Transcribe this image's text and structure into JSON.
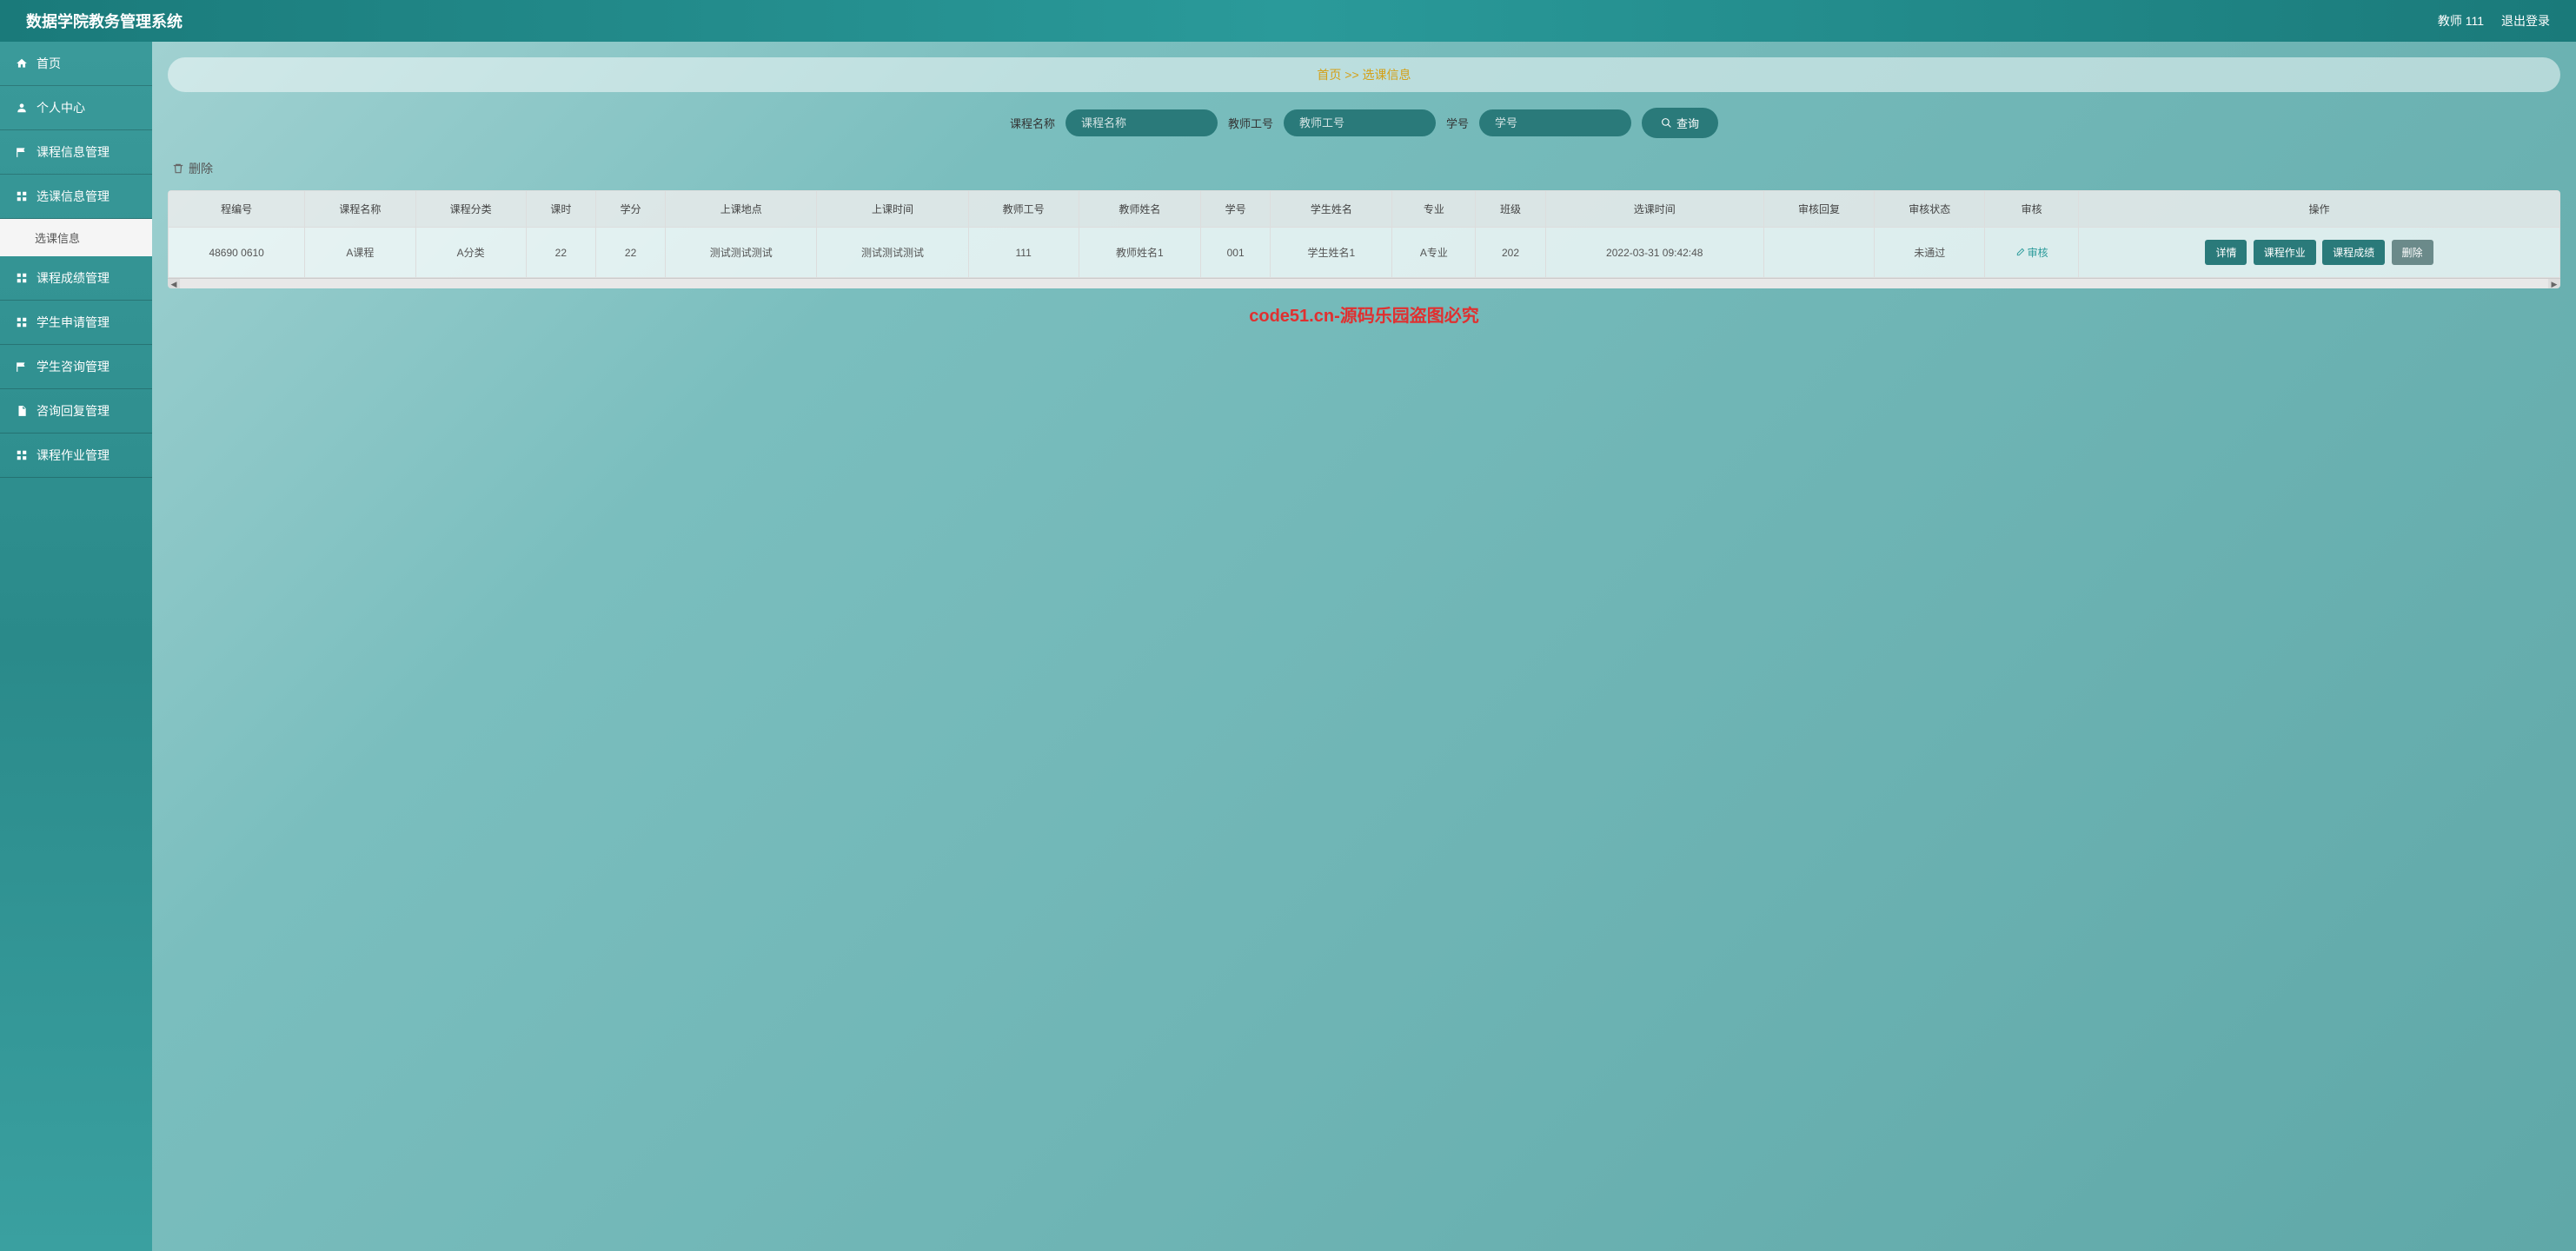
{
  "header": {
    "title": "数据学院教务管理系统",
    "user": "教师 111",
    "logout": "退出登录"
  },
  "sidebar": {
    "items": [
      {
        "icon": "home",
        "label": "首页"
      },
      {
        "icon": "user",
        "label": "个人中心"
      },
      {
        "icon": "flag",
        "label": "课程信息管理"
      },
      {
        "icon": "grid",
        "label": "选课信息管理",
        "sub": [
          {
            "label": "选课信息"
          }
        ]
      },
      {
        "icon": "grid",
        "label": "课程成绩管理"
      },
      {
        "icon": "grid",
        "label": "学生申请管理"
      },
      {
        "icon": "flag",
        "label": "学生咨询管理"
      },
      {
        "icon": "doc",
        "label": "咨询回复管理"
      },
      {
        "icon": "grid",
        "label": "课程作业管理"
      }
    ]
  },
  "breadcrumb": {
    "text": "首页 >> 选课信息"
  },
  "search": {
    "course_label": "课程名称",
    "course_placeholder": "课程名称",
    "teacher_label": "教师工号",
    "teacher_placeholder": "教师工号",
    "student_label": "学号",
    "student_placeholder": "学号",
    "search_btn": "查询"
  },
  "toolbar": {
    "delete_label": "删除"
  },
  "table": {
    "headers": [
      "程编号",
      "课程名称",
      "课程分类",
      "课时",
      "学分",
      "上课地点",
      "上课时间",
      "教师工号",
      "教师姓名",
      "学号",
      "学生姓名",
      "专业",
      "班级",
      "选课时间",
      "审核回复",
      "审核状态",
      "审核",
      "操作"
    ],
    "row": {
      "c0": "48690 0610",
      "c1": "A课程",
      "c2": "A分类",
      "c3": "22",
      "c4": "22",
      "c5": "测试测试测试",
      "c6": "测试测试测试",
      "c7": "111",
      "c8": "教师姓名1",
      "c9": "001",
      "c10": "学生姓名1",
      "c11": "A专业",
      "c12": "202",
      "c13": "2022-03-31 09:42:48",
      "c14": "",
      "c15": "未通过",
      "audit": "审核"
    },
    "actions": {
      "detail": "详情",
      "homework": "课程作业",
      "grade": "课程成绩",
      "delete": "删除"
    }
  },
  "watermark": "code51.cn-源码乐园盗图必究",
  "bg_watermark": "code51.cn"
}
